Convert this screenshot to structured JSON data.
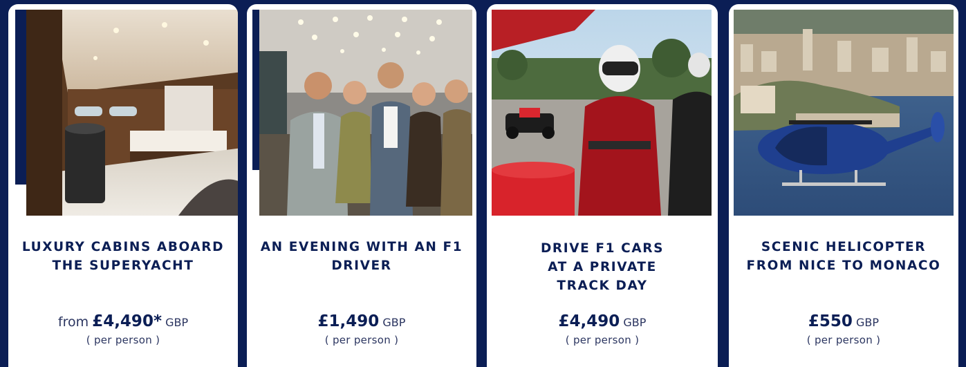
{
  "cards": [
    {
      "title_line1": "LUXURY CABINS ABOARD",
      "title_line2": "THE SUPERYACHT",
      "price_prefix": "from",
      "price": "£4,490*",
      "currency": "GBP",
      "per_person": "( per person )",
      "image": "yacht-cabin-photo"
    },
    {
      "title_line1": "AN EVENING WITH AN F1",
      "title_line2": "DRIVER",
      "price_prefix": "",
      "price": "£1,490",
      "currency": "GBP",
      "per_person": "( per person )",
      "image": "group-with-f1-driver-photo"
    },
    {
      "title_line1": "DRIVE F1 CARS",
      "title_line2": "AT A PRIVATE",
      "title_line3": "TRACK DAY",
      "price_prefix": "",
      "price": "£4,490",
      "currency": "GBP",
      "per_person": "( per person )",
      "image": "f1-track-day-photo"
    },
    {
      "title_line1": "SCENIC HELICOPTER",
      "title_line2": "FROM NICE TO MONACO",
      "price_prefix": "",
      "price": "£550",
      "currency": "GBP",
      "per_person": "( per person )",
      "image": "helicopter-over-monaco-photo"
    }
  ],
  "colors": {
    "navy": "#0b1e55",
    "card_bg": "#ffffff"
  }
}
